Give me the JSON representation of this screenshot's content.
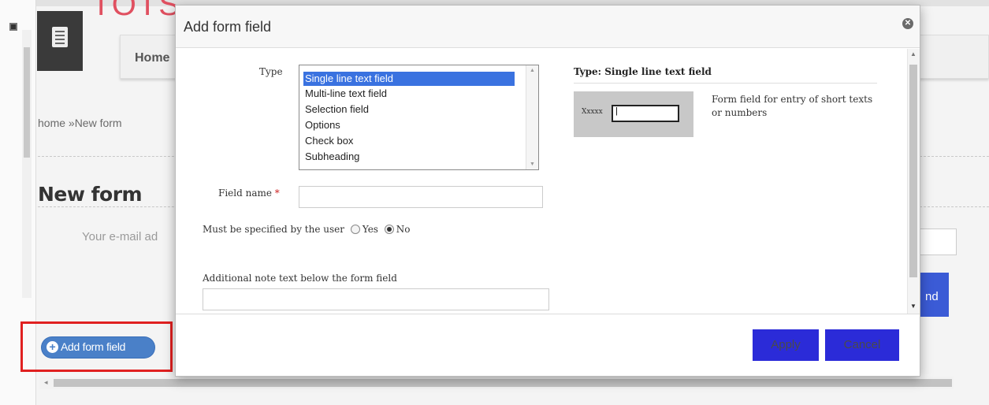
{
  "background": {
    "logo_text": "TOTS",
    "nav_home": "Home",
    "breadcrumb": "home  »New form",
    "page_title": "New form",
    "email_label": "Your e-mail ad",
    "send_label": "nd",
    "add_field_button": "Add form field"
  },
  "modal": {
    "title": "Add form field",
    "type_label": "Type",
    "type_options": [
      "Single line text field",
      "Multi-line text field",
      "Selection field",
      "Options",
      "Check box",
      "Subheading"
    ],
    "selected_type": "Single line text field",
    "field_name_label": "Field name",
    "required_mark": "*",
    "field_name_value": "",
    "must_label": "Must be specified by the user",
    "must_yes": "Yes",
    "must_no": "No",
    "must_selected": "No",
    "note_label": "Additional note text below the form field",
    "note_value": "",
    "preview": {
      "title": "Type: Single line text field",
      "example_label": "Xxxxx",
      "example_value": "|",
      "description": "Form field for entry of short texts or numbers"
    },
    "buttons": {
      "apply": "Apply",
      "cancel": "Cancel"
    }
  },
  "colors": {
    "selection": "#3a72e0",
    "button_primary": "#2b2bd8",
    "highlight": "#e02020",
    "logo": "#e05060",
    "add_button": "#4a80c8"
  }
}
